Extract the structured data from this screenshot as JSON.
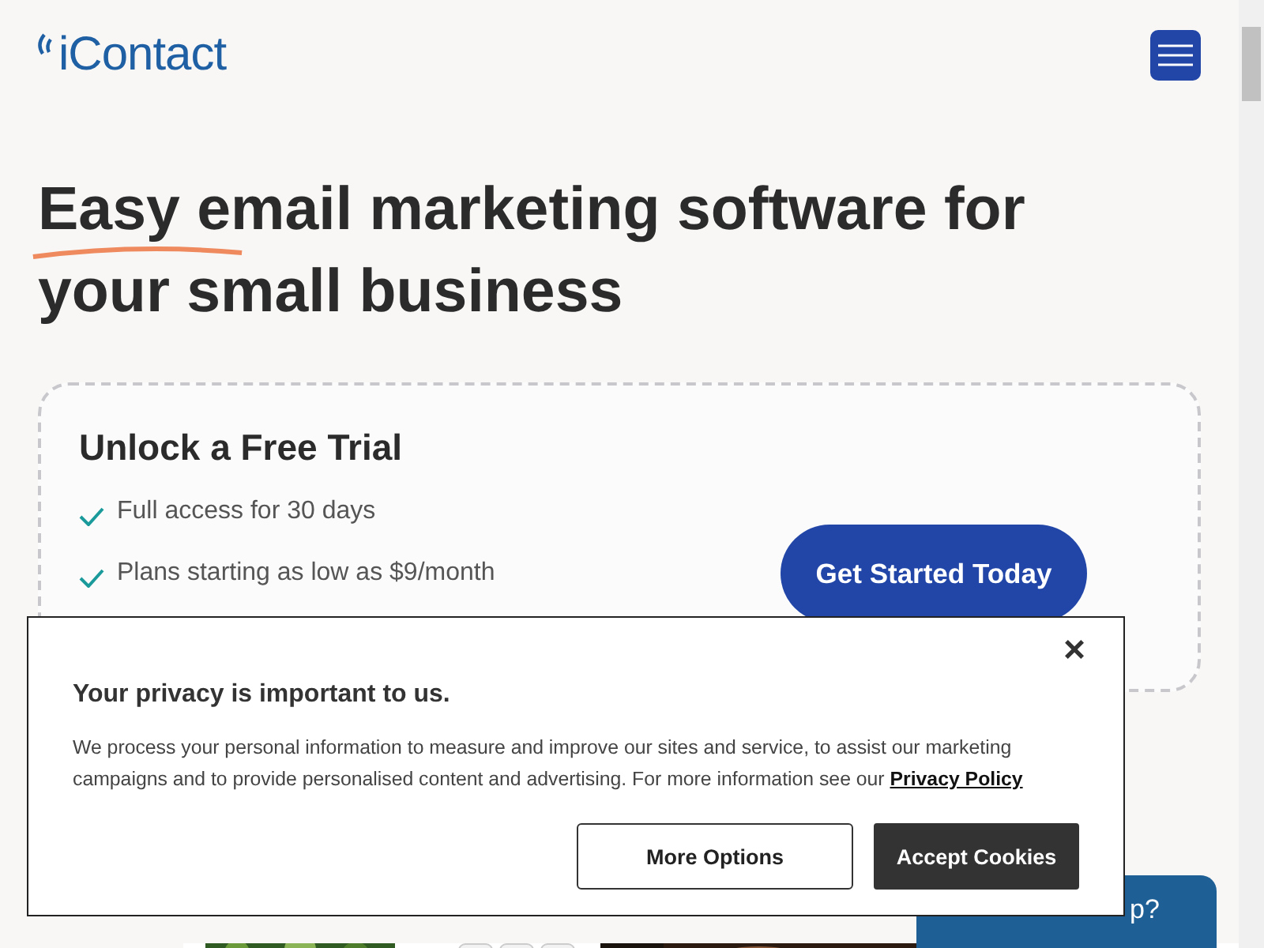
{
  "header": {
    "logo": "iContact"
  },
  "hero": {
    "title_lines": [
      "Easy email marketing software for",
      "your small business"
    ]
  },
  "trial_card": {
    "title": "Unlock a Free Trial",
    "benefits": [
      "Full access for 30 days",
      "Plans starting as low as $9/month"
    ],
    "button": "Get Started Today"
  },
  "cookie_banner": {
    "title": "Your privacy is important to us.",
    "body": "We process your personal information to measure and improve our sites and service, to assist our marketing campaigns and to provide personalised content and advertising. For more information see our",
    "link": "Privacy Policy",
    "close": "×",
    "buttons": [
      {
        "label": "More Options",
        "kind": "secondary"
      },
      {
        "label": "Accept Cookies",
        "kind": "primary"
      }
    ]
  },
  "chat_widget": {
    "text": "p?"
  }
}
